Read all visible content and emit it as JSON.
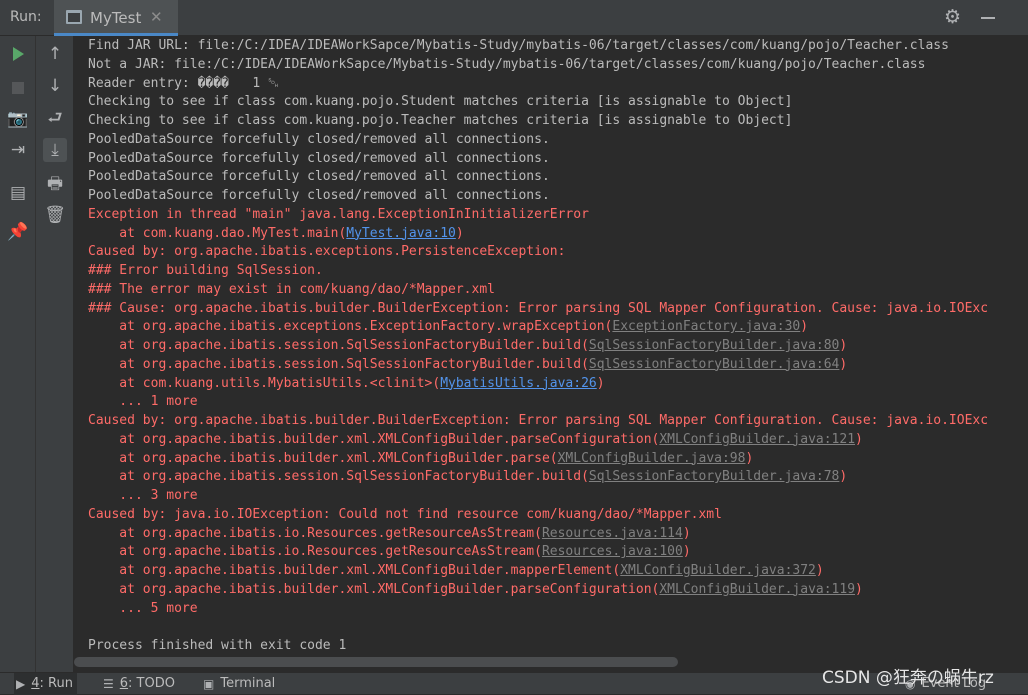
{
  "header": {
    "run_label": "Run:",
    "tab_title": "MyTest",
    "tab_close": "✕",
    "settings_icon": "gear-icon",
    "minimize_icon": "minimize-icon"
  },
  "toolbar": {
    "col1": [
      {
        "name": "rerun-icon",
        "glyph": "▶"
      },
      {
        "name": "stop-icon",
        "glyph": "■"
      },
      {
        "name": "camera-icon",
        "glyph": "📷"
      },
      {
        "name": "restore-layout-icon",
        "glyph": "⇥"
      },
      {
        "name": "layout-icon",
        "glyph": "▤"
      },
      {
        "name": "pin-icon",
        "glyph": "📌"
      }
    ],
    "col2": [
      {
        "name": "scroll-up-icon",
        "glyph": "↑"
      },
      {
        "name": "scroll-down-icon",
        "glyph": "↓"
      },
      {
        "name": "soft-wrap-icon",
        "glyph": "⮐"
      },
      {
        "name": "scroll-to-end-icon",
        "glyph": "⤓"
      },
      {
        "name": "print-icon",
        "glyph": "🖶"
      },
      {
        "name": "clear-all-icon",
        "glyph": "🗑"
      }
    ]
  },
  "console": {
    "lines": [
      {
        "t": "Find JAR URL: file:/C:/IDEA/IDEAWorkSapce/Mybatis-Study/mybatis-06/target/classes/com/kuang/pojo/Teacher.class",
        "type": "info"
      },
      {
        "t": "Not a JAR: file:/C:/IDEA/IDEAWorkSapce/Mybatis-Study/mybatis-06/target/classes/com/kuang/pojo/Teacher.class",
        "type": "info"
      },
      {
        "t": "Reader entry: ����   1 ␁",
        "type": "info"
      },
      {
        "t": "Checking to see if class com.kuang.pojo.Student matches criteria [is assignable to Object]",
        "type": "info"
      },
      {
        "t": "Checking to see if class com.kuang.pojo.Teacher matches criteria [is assignable to Object]",
        "type": "info"
      },
      {
        "t": "PooledDataSource forcefully closed/removed all connections.",
        "type": "info"
      },
      {
        "t": "PooledDataSource forcefully closed/removed all connections.",
        "type": "info"
      },
      {
        "t": "PooledDataSource forcefully closed/removed all connections.",
        "type": "info"
      },
      {
        "t": "PooledDataSource forcefully closed/removed all connections.",
        "type": "info"
      },
      {
        "t": "Exception in thread \"main\" java.lang.ExceptionInInitializerError",
        "type": "err"
      },
      {
        "t": "    at com.kuang.dao.MyTest.main(",
        "type": "err",
        "link": "MyTest.java:10",
        "linkStyle": "blue",
        "post": ")"
      },
      {
        "t": "Caused by: org.apache.ibatis.exceptions.PersistenceException:",
        "type": "err"
      },
      {
        "t": "### Error building SqlSession.",
        "type": "err"
      },
      {
        "t": "### The error may exist in com/kuang/dao/*Mapper.xml",
        "type": "err"
      },
      {
        "t": "### Cause: org.apache.ibatis.builder.BuilderException: Error parsing SQL Mapper Configuration. Cause: java.io.IOExc",
        "type": "err"
      },
      {
        "t": "    at org.apache.ibatis.exceptions.ExceptionFactory.wrapException(",
        "type": "err",
        "link": "ExceptionFactory.java:30",
        "linkStyle": "dim",
        "post": ")"
      },
      {
        "t": "    at org.apache.ibatis.session.SqlSessionFactoryBuilder.build(",
        "type": "err",
        "link": "SqlSessionFactoryBuilder.java:80",
        "linkStyle": "dim",
        "post": ")"
      },
      {
        "t": "    at org.apache.ibatis.session.SqlSessionFactoryBuilder.build(",
        "type": "err",
        "link": "SqlSessionFactoryBuilder.java:64",
        "linkStyle": "dim",
        "post": ")"
      },
      {
        "t": "    at com.kuang.utils.MybatisUtils.<clinit>(",
        "type": "err",
        "link": "MybatisUtils.java:26",
        "linkStyle": "blue",
        "post": ")"
      },
      {
        "t": "    ... 1 more",
        "type": "err"
      },
      {
        "t": "Caused by: org.apache.ibatis.builder.BuilderException: Error parsing SQL Mapper Configuration. Cause: java.io.IOExc",
        "type": "err"
      },
      {
        "t": "    at org.apache.ibatis.builder.xml.XMLConfigBuilder.parseConfiguration(",
        "type": "err",
        "link": "XMLConfigBuilder.java:121",
        "linkStyle": "dim",
        "post": ")"
      },
      {
        "t": "    at org.apache.ibatis.builder.xml.XMLConfigBuilder.parse(",
        "type": "err",
        "link": "XMLConfigBuilder.java:98",
        "linkStyle": "dim",
        "post": ")"
      },
      {
        "t": "    at org.apache.ibatis.session.SqlSessionFactoryBuilder.build(",
        "type": "err",
        "link": "SqlSessionFactoryBuilder.java:78",
        "linkStyle": "dim",
        "post": ")"
      },
      {
        "t": "    ... 3 more",
        "type": "err"
      },
      {
        "t": "Caused by: java.io.IOException: Could not find resource com/kuang/dao/*Mapper.xml",
        "type": "err"
      },
      {
        "t": "    at org.apache.ibatis.io.Resources.getResourceAsStream(",
        "type": "err",
        "link": "Resources.java:114",
        "linkStyle": "dim",
        "post": ")"
      },
      {
        "t": "    at org.apache.ibatis.io.Resources.getResourceAsStream(",
        "type": "err",
        "link": "Resources.java:100",
        "linkStyle": "dim",
        "post": ")"
      },
      {
        "t": "    at org.apache.ibatis.builder.xml.XMLConfigBuilder.mapperElement(",
        "type": "err",
        "link": "XMLConfigBuilder.java:372",
        "linkStyle": "dim",
        "post": ")"
      },
      {
        "t": "    at org.apache.ibatis.builder.xml.XMLConfigBuilder.parseConfiguration(",
        "type": "err",
        "link": "XMLConfigBuilder.java:119",
        "linkStyle": "dim",
        "post": ")"
      },
      {
        "t": "    ... 5 more",
        "type": "err"
      },
      {
        "t": "",
        "type": "info"
      },
      {
        "t": "Process finished with exit code 1",
        "type": "info"
      }
    ]
  },
  "statusbar": {
    "tabs": [
      {
        "name": "tab-run",
        "icon": "▶",
        "num": "4",
        "label": ": Run",
        "active": true
      },
      {
        "name": "tab-todo",
        "icon": "☰",
        "num": "6",
        "label": ": TODO",
        "active": false
      },
      {
        "name": "tab-terminal",
        "icon": "▣",
        "num": "",
        "label": "Terminal",
        "active": false
      }
    ],
    "event_log": "Event Log"
  },
  "watermark": "CSDN @狂奔の蜗牛rz",
  "colors": {
    "error": "#ff6b68",
    "info": "#bbbbbb",
    "link": "#5394ec",
    "accent": "#4a88c7",
    "run_green": "#59a869"
  }
}
